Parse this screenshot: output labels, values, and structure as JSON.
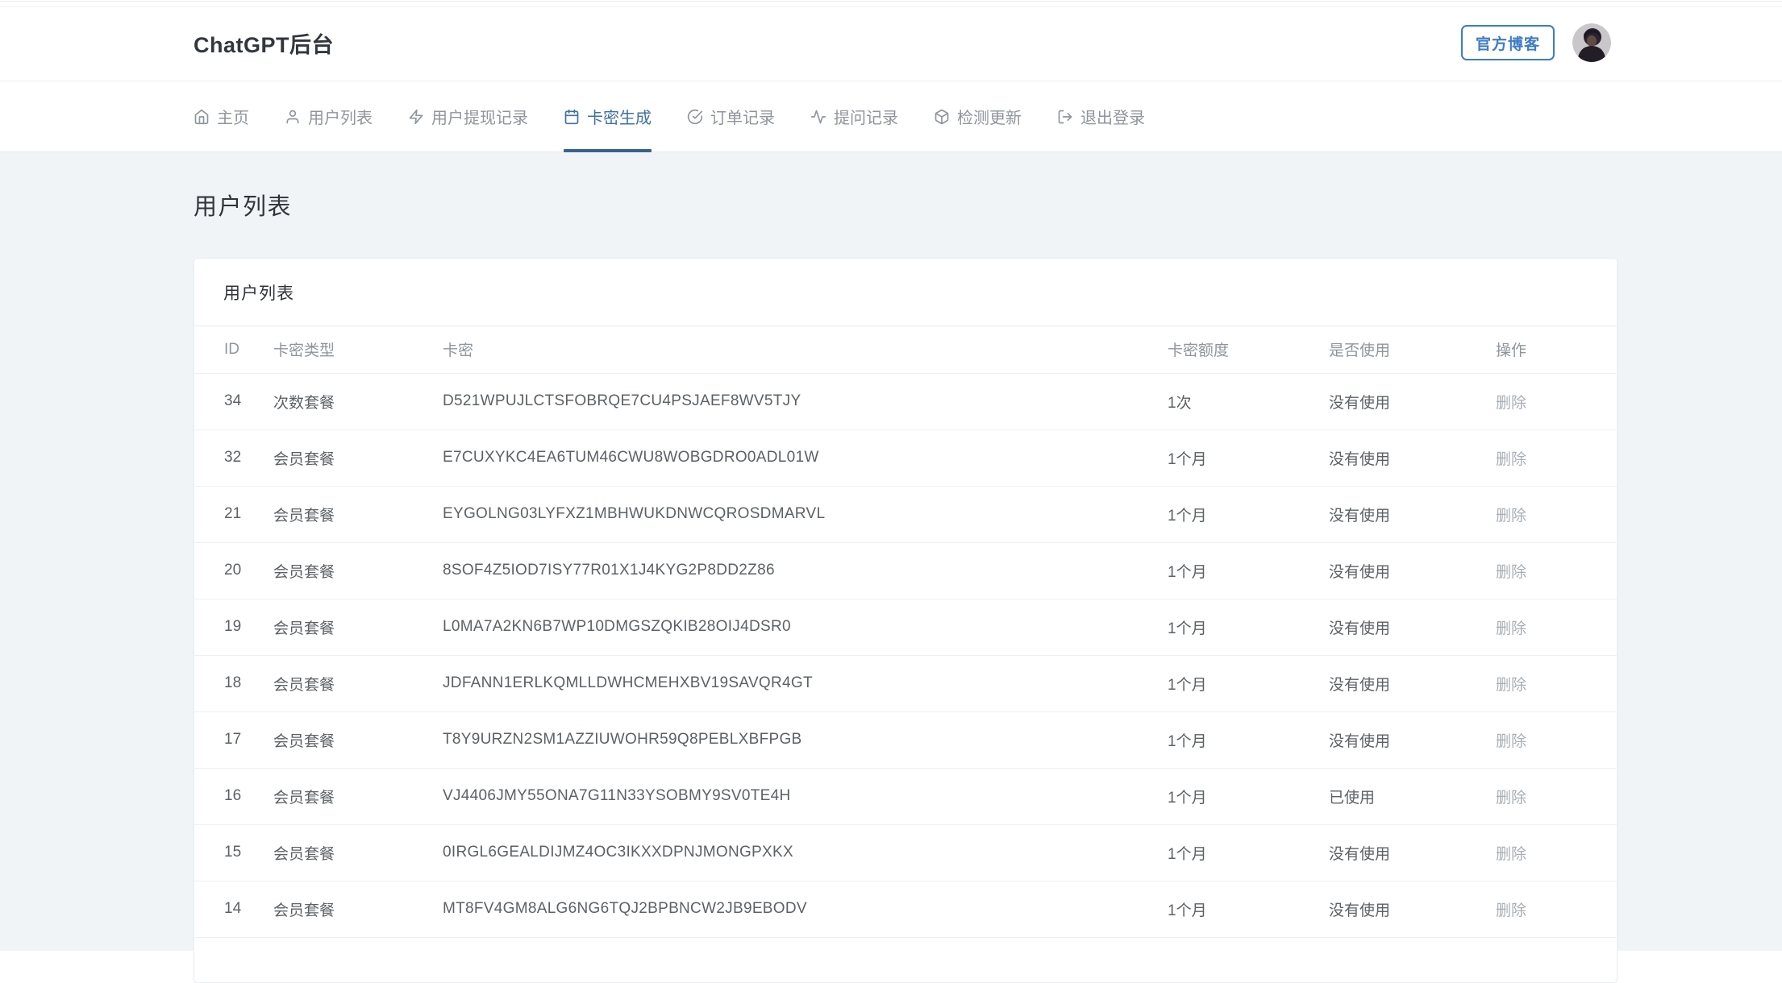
{
  "theme": {
    "accent_active_nav": "#40719f",
    "accent_underline": "#36648f",
    "blog_button_blue": "#3e7cc3",
    "content_background": "#f1f4f7",
    "muted_text": "#8f959c",
    "body_text": "#5c6166"
  },
  "header": {
    "title": "ChatGPT后台",
    "blog_button": "官方博客",
    "avatar_icon": "user-photo"
  },
  "nav": {
    "items": [
      {
        "label": "主页",
        "icon": "home",
        "active": false
      },
      {
        "label": "用户列表",
        "icon": "user",
        "active": false
      },
      {
        "label": "用户提现记录",
        "icon": "zap",
        "active": false
      },
      {
        "label": "卡密生成",
        "icon": "calendar",
        "active": true
      },
      {
        "label": "订单记录",
        "icon": "check-circle",
        "active": false
      },
      {
        "label": "提问记录",
        "icon": "activity",
        "active": false
      },
      {
        "label": "检测更新",
        "icon": "package",
        "active": false
      },
      {
        "label": "退出登录",
        "icon": "log-out",
        "active": false
      }
    ]
  },
  "page": {
    "title": "用户列表"
  },
  "card": {
    "title": "用户列表"
  },
  "table": {
    "columns": [
      "ID",
      "卡密类型",
      "卡密",
      "卡密额度",
      "是否使用",
      "操作"
    ],
    "rows": [
      {
        "id": "34",
        "type": "次数套餐",
        "key": "D521WPUJLCTSFOBRQE7CU4PSJAEF8WV5TJY",
        "quota": "1次",
        "used": "没有使用",
        "action": "删除"
      },
      {
        "id": "32",
        "type": "会员套餐",
        "key": "E7CUXYKC4EA6TUM46CWU8WOBGDRO0ADL01W",
        "quota": "1个月",
        "used": "没有使用",
        "action": "删除"
      },
      {
        "id": "21",
        "type": "会员套餐",
        "key": "EYGOLNG03LYFXZ1MBHWUKDNWCQROSDMARVL",
        "quota": "1个月",
        "used": "没有使用",
        "action": "删除"
      },
      {
        "id": "20",
        "type": "会员套餐",
        "key": "8SOF4Z5IOD7ISY77R01X1J4KYG2P8DD2Z86",
        "quota": "1个月",
        "used": "没有使用",
        "action": "删除"
      },
      {
        "id": "19",
        "type": "会员套餐",
        "key": "L0MA7A2KN6B7WP10DMGSZQKIB28OIJ4DSR0",
        "quota": "1个月",
        "used": "没有使用",
        "action": "删除"
      },
      {
        "id": "18",
        "type": "会员套餐",
        "key": "JDFANN1ERLKQMLLDWHCMEHXBV19SAVQR4GT",
        "quota": "1个月",
        "used": "没有使用",
        "action": "删除"
      },
      {
        "id": "17",
        "type": "会员套餐",
        "key": "T8Y9URZN2SM1AZZIUWOHR59Q8PEBLXBFPGB",
        "quota": "1个月",
        "used": "没有使用",
        "action": "删除"
      },
      {
        "id": "16",
        "type": "会员套餐",
        "key": "VJ4406JMY55ONA7G11N33YSOBMY9SV0TE4H",
        "quota": "1个月",
        "used": "已使用",
        "action": "删除"
      },
      {
        "id": "15",
        "type": "会员套餐",
        "key": "0IRGL6GEALDIJMZ4OC3IKXXDPNJMONGPXKX",
        "quota": "1个月",
        "used": "没有使用",
        "action": "删除"
      },
      {
        "id": "14",
        "type": "会员套餐",
        "key": "MT8FV4GM8ALG6NG6TQJ2BPBNCW2JB9EBODV",
        "quota": "1个月",
        "used": "没有使用",
        "action": "删除"
      }
    ]
  }
}
